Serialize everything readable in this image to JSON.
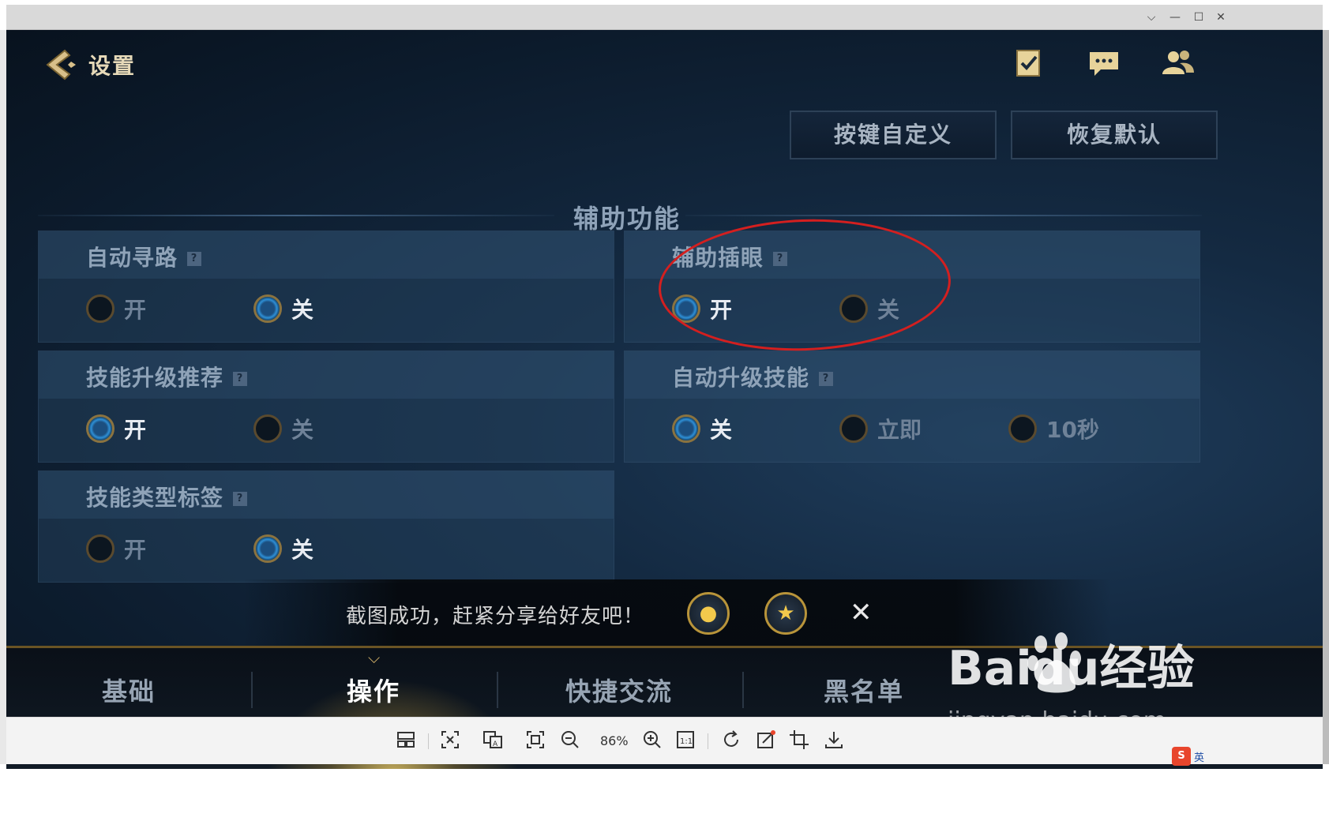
{
  "window": {
    "controls": {
      "collapse": "⌵",
      "minimize": "—",
      "maximize": "☐",
      "close": "✕"
    }
  },
  "header": {
    "title": "设置",
    "icons": [
      "back-arrow-icon",
      "task-checklist-icon",
      "chat-bubble-icon",
      "friends-icon"
    ]
  },
  "top_buttons": {
    "customize": "按键自定义",
    "restore": "恢复默认"
  },
  "section": {
    "title": "辅助功能"
  },
  "settings": [
    {
      "label": "自动寻路",
      "options": [
        {
          "text": "开",
          "selected": false
        },
        {
          "text": "关",
          "selected": true
        }
      ]
    },
    {
      "label": "辅助插眼",
      "options": [
        {
          "text": "开",
          "selected": true
        },
        {
          "text": "关",
          "selected": false
        }
      ]
    },
    {
      "label": "技能升级推荐",
      "options": [
        {
          "text": "开",
          "selected": true
        },
        {
          "text": "关",
          "selected": false
        }
      ]
    },
    {
      "label": "自动升级技能",
      "options": [
        {
          "text": "关",
          "selected": true
        },
        {
          "text": "立即",
          "selected": false
        },
        {
          "text": "10秒",
          "selected": false
        }
      ]
    },
    {
      "label": "技能类型标签",
      "options": [
        {
          "text": "开",
          "selected": false
        },
        {
          "text": "关",
          "selected": true
        }
      ]
    }
  ],
  "help_mark": "?",
  "toast": {
    "message": "截图成功，赶紧分享给好友吧！",
    "close": "✕",
    "icons": [
      "qq-share-icon",
      "qzone-star-icon"
    ]
  },
  "tabs": [
    {
      "label": "基础",
      "active": false
    },
    {
      "label": "操作",
      "active": true
    },
    {
      "label": "快捷交流",
      "active": false
    },
    {
      "label": "黑名单",
      "active": false
    }
  ],
  "watermark": {
    "brand": "Baidu经验",
    "url": "jingyan.baidu.com"
  },
  "viewer_toolbar": {
    "zoom": "86%",
    "icons": [
      "layout-icon",
      "fit-screen-icon",
      "translate-icon",
      "fullscreen-icon",
      "zoom-out-icon",
      "zoom-in-icon",
      "actual-size-icon",
      "rotate-icon",
      "edit-icon",
      "crop-icon",
      "download-icon"
    ]
  },
  "ime": {
    "logo": "S",
    "lang": "英"
  },
  "colors": {
    "accent_gold": "#d6b46a",
    "radio_blue": "#2e8fd6",
    "highlight_red": "#d41f1f"
  }
}
